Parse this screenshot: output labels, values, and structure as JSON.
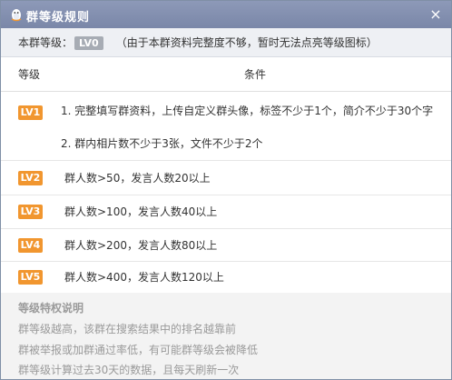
{
  "window": {
    "title": "群等级规则",
    "close_icon": "×"
  },
  "current": {
    "prefix": "本群等级：",
    "level": "LV0",
    "note": "（由于本群资料完整度不够，暂时无法点亮等级图标）"
  },
  "table": {
    "headers": [
      "等级",
      "条件"
    ],
    "rows": [
      {
        "level": "LV1",
        "conditions": [
          "1. 完整填写群资料，上传自定义群头像，标签不少于1个，简介不少于30个字",
          "2. 群内相片数不少于3张，文件不少于2个"
        ]
      },
      {
        "level": "LV2",
        "conditions": [
          "群人数>50，发言人数20以上"
        ]
      },
      {
        "level": "LV3",
        "conditions": [
          "群人数>100，发言人数40以上"
        ]
      },
      {
        "level": "LV4",
        "conditions": [
          "群人数>200，发言人数80以上"
        ]
      },
      {
        "level": "LV5",
        "conditions": [
          "群人数>400，发言人数120以上"
        ]
      }
    ]
  },
  "footer": {
    "title": "等级特权说明",
    "lines": [
      "群等级越高，该群在搜索结果中的排名越靠前",
      "群被举报或加群通过率低，有可能群等级会被降低",
      "群等级计算过去30天的数据，且每天刷新一次"
    ]
  },
  "colors": {
    "titlebar": "#8592b2",
    "badge_orange": "#f1962f",
    "badge_gray": "#a7acb4"
  }
}
